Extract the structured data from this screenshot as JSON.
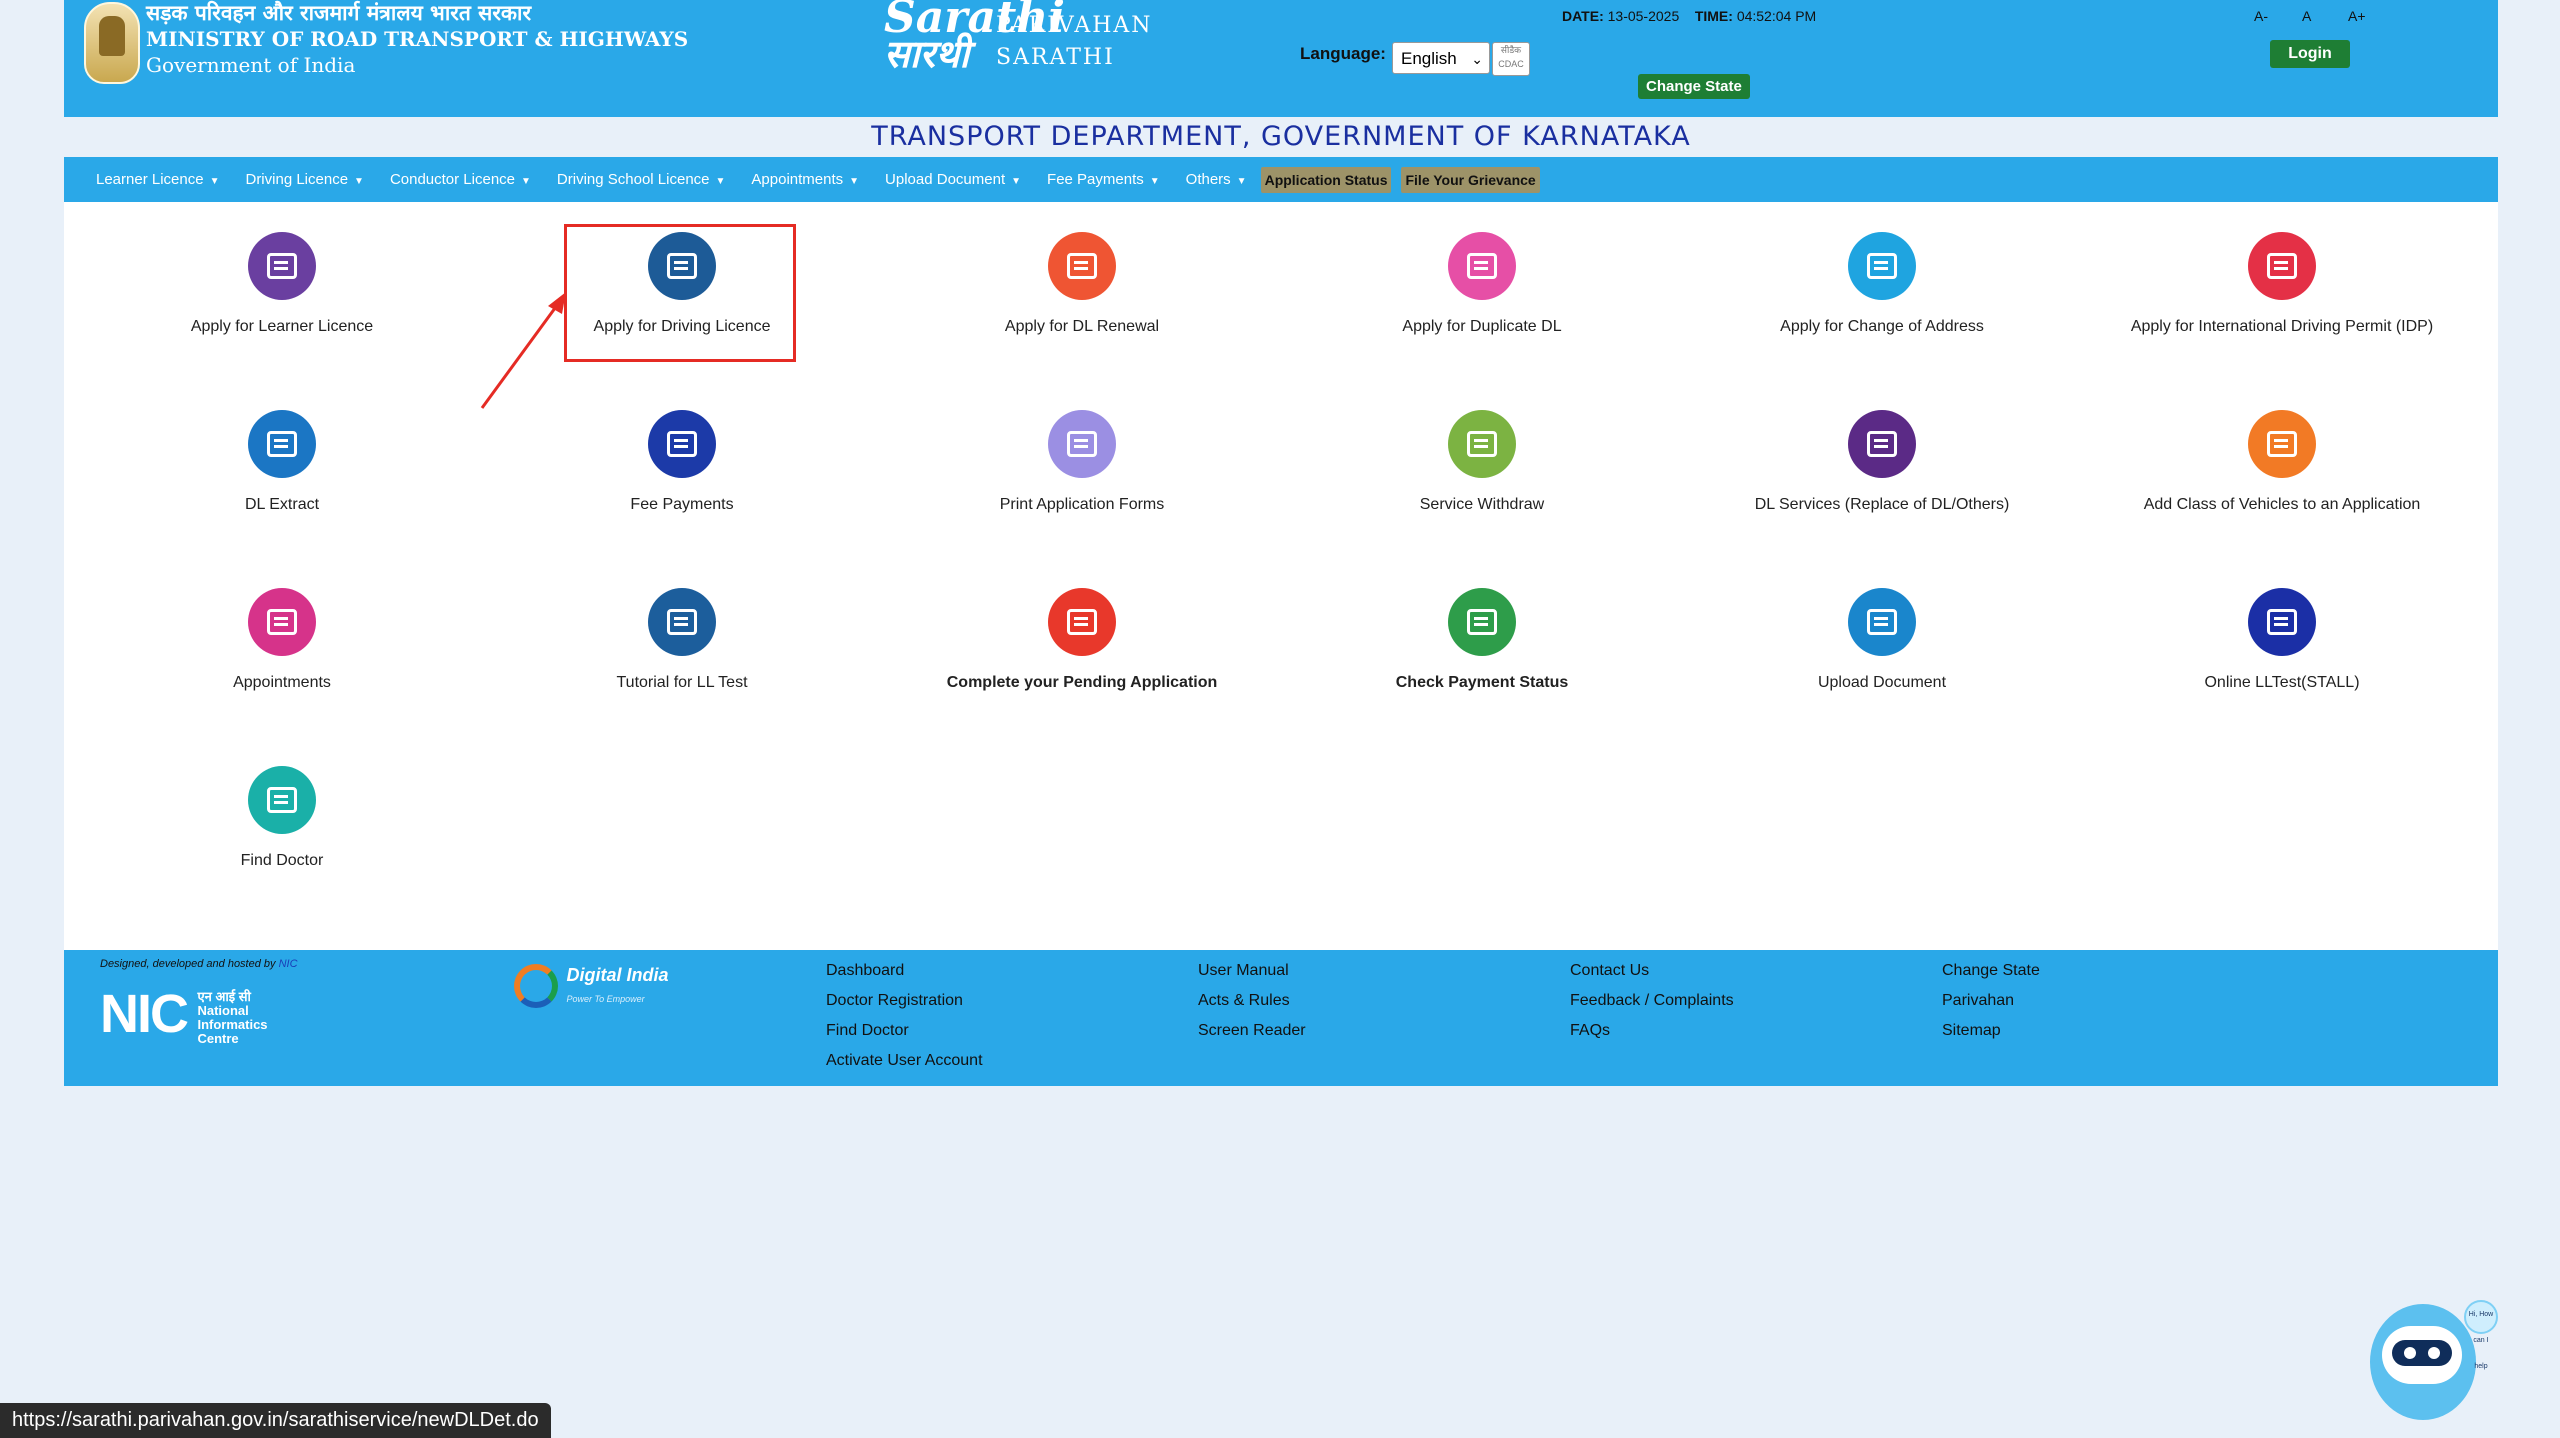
{
  "header": {
    "ministry_hindi": "सड़क परिवहन और राजमार्ग मंत्रालय भारत सरकार",
    "ministry_english": "MINISTRY OF ROAD TRANSPORT & HIGHWAYS",
    "government": "Government of India",
    "logo_sarathi_en": "Sarathi",
    "logo_sarathi_hi": "सारथी",
    "logo_line1": "PARIVAHAN",
    "logo_line2": "SARATHI",
    "language_label": "Language:",
    "language_value": "English",
    "cdac_label": "सीडैक CDAC",
    "date_label": "DATE:",
    "date_value": "13-05-2025",
    "time_label": "TIME:",
    "time_value": "04:52:04 PM",
    "font_small": "A-",
    "font_normal": "A",
    "font_large": "A+",
    "change_state": "Change State",
    "login": "Login"
  },
  "department_title": "TRANSPORT DEPARTMENT, GOVERNMENT OF KARNATAKA",
  "nav": {
    "items": [
      {
        "label": "Learner Licence"
      },
      {
        "label": "Driving Licence"
      },
      {
        "label": "Conductor Licence"
      },
      {
        "label": "Driving School Licence"
      },
      {
        "label": "Appointments"
      },
      {
        "label": "Upload Document"
      },
      {
        "label": "Fee Payments"
      },
      {
        "label": "Others"
      }
    ],
    "application_status": "Application Status",
    "file_grievance": "File Your Grievance"
  },
  "services": [
    {
      "label": "Apply for Learner Licence",
      "color": "#6a3fa0",
      "icon": "learner-licence-icon"
    },
    {
      "label": "Apply for Driving Licence",
      "color": "#1d5b97",
      "icon": "driving-licence-icon"
    },
    {
      "label": "Apply for DL Renewal",
      "color": "#ef5533",
      "icon": "dl-renewal-icon"
    },
    {
      "label": "Apply for Duplicate DL",
      "color": "#e64fa6",
      "icon": "duplicate-dl-icon"
    },
    {
      "label": "Apply for Change of Address",
      "color": "#1fa4e0",
      "icon": "location-pin-icon"
    },
    {
      "label": "Apply for International Driving Permit (IDP)",
      "color": "#e43046",
      "icon": "idp-icon"
    },
    {
      "label": "DL Extract",
      "color": "#1b76c4",
      "icon": "share-icon"
    },
    {
      "label": "Fee Payments",
      "color": "#1c3aa8",
      "icon": "payment-icon"
    },
    {
      "label": "Print Application Forms",
      "color": "#9b8fe3",
      "icon": "printer-icon"
    },
    {
      "label": "Service Withdraw",
      "color": "#7cb342",
      "icon": "withdraw-icon"
    },
    {
      "label": "DL Services (Replace of DL/Others)",
      "color": "#5b2a86",
      "icon": "id-card-icon"
    },
    {
      "label": "Add Class of Vehicles to an Application",
      "color": "#f27a25",
      "icon": "form-icon"
    },
    {
      "label": "Appointments",
      "color": "#d6338a",
      "icon": "calendar-icon"
    },
    {
      "label": "Tutorial for LL Test",
      "color": "#1c5e9c",
      "icon": "checklist-icon"
    },
    {
      "label": "Complete your Pending Application",
      "color": "#e8382b",
      "icon": "pending-doc-icon"
    },
    {
      "label": "Check Payment Status",
      "color": "#2e9d4a",
      "icon": "payment-status-icon"
    },
    {
      "label": "Upload Document",
      "color": "#1a86cc",
      "icon": "upload-icon"
    },
    {
      "label": "Online LLTest(STALL)",
      "color": "#1b2fa6",
      "icon": "online-test-icon"
    },
    {
      "label": "Find Doctor",
      "color": "#1ab0a8",
      "icon": "doctor-icon"
    }
  ],
  "footer": {
    "designed_by": "Designed, developed and hosted by",
    "designed_by_org": "NIC",
    "nic_big": "NIC",
    "nic_hindi": "एन आई सी",
    "nic_line1": "National",
    "nic_line2": "Informatics",
    "nic_line3": "Centre",
    "digital_india": "Digital India",
    "digital_india_tagline": "Power To Empower",
    "col1": [
      "Dashboard",
      "Doctor Registration",
      "Find Doctor",
      "Activate User Account"
    ],
    "col2": [
      "User Manual",
      "Acts & Rules",
      "Screen Reader"
    ],
    "col3": [
      "Contact Us",
      "Feedback / Complaints",
      "FAQs"
    ],
    "col4": [
      "Change State",
      "Parivahan",
      "Sitemap"
    ]
  },
  "status_url": "https://sarathi.parivahan.gov.in/sarathiservice/newDLDet.do",
  "chatbot_bubble": "Hi, How can I help"
}
